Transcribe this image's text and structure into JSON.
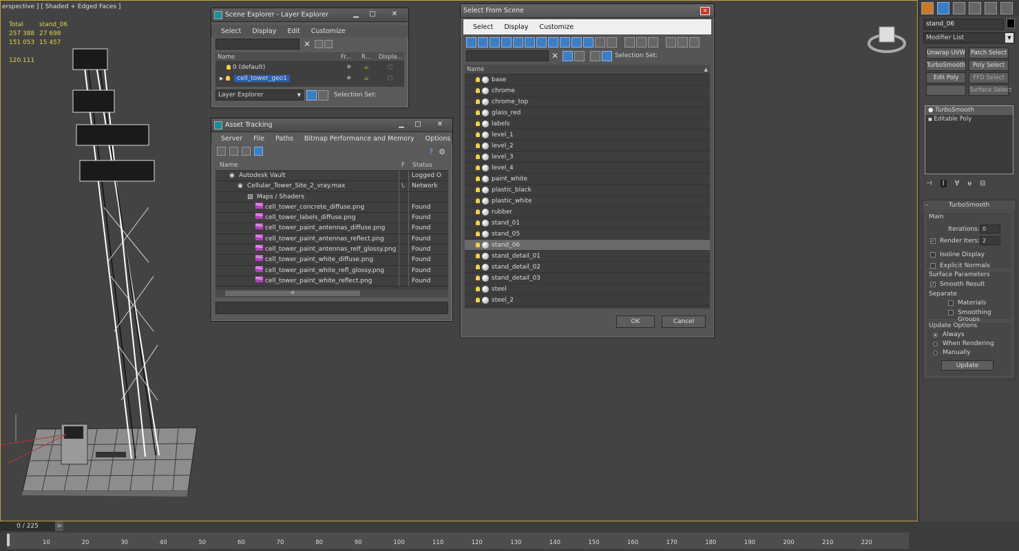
{
  "viewport": {
    "label": "erspective ] [ Shaded + Edged Faces ]",
    "stats": [
      {
        "k": "Total",
        "v": "stand_06"
      },
      {
        "k": "257 388",
        "v": "27 698"
      },
      {
        "k": "151 053",
        "v": "15 457"
      },
      {
        "k": "",
        "v": ""
      },
      {
        "k": "120.111",
        "v": ""
      }
    ]
  },
  "scene_explorer": {
    "title": "Scene Explorer - Layer Explorer",
    "menu": [
      "Select",
      "Display",
      "Edit",
      "Customize"
    ],
    "columns": [
      "Name",
      "Fr...",
      "R...",
      "Displa..."
    ],
    "rows": [
      {
        "name": "0 (default)"
      },
      {
        "name": "cell_tower_geo1"
      }
    ],
    "footer_dropdown": "Layer Explorer",
    "selection_set": "Selection Set:"
  },
  "asset_tracking": {
    "title": "Asset Tracking",
    "menu": [
      "Server",
      "File",
      "Paths",
      "Bitmap Performance and Memory",
      "Options"
    ],
    "columns": [
      "Name",
      "F",
      "Status"
    ],
    "rows": [
      {
        "name": "Autodesk Vault",
        "f": "",
        "status": "Logged O",
        "indent": 1
      },
      {
        "name": "Cellular_Tower_Site_2_vray.max",
        "f": "\\.",
        "status": "Network",
        "indent": 2
      },
      {
        "name": "Maps / Shaders",
        "f": "",
        "status": "",
        "indent": 3
      },
      {
        "name": "cell_tower_concrete_diffuse.png",
        "f": "",
        "status": "Found",
        "indent": 4
      },
      {
        "name": "cell_tower_labels_diffuse.png",
        "f": "",
        "status": "Found",
        "indent": 4
      },
      {
        "name": "cell_tower_paint_antennas_diffuse.png",
        "f": "",
        "status": "Found",
        "indent": 4
      },
      {
        "name": "cell_tower_paint_antennas_reflect.png",
        "f": "",
        "status": "Found",
        "indent": 4
      },
      {
        "name": "cell_tower_paint_antennas_relf_glossy.png",
        "f": "",
        "status": "Found",
        "indent": 4
      },
      {
        "name": "cell_tower_paint_white_diffuse.png",
        "f": "",
        "status": "Found",
        "indent": 4
      },
      {
        "name": "cell_tower_paint_white_refl_glossy.png",
        "f": "",
        "status": "Found",
        "indent": 4
      },
      {
        "name": "cell_tower_paint_white_reflect.png",
        "f": "",
        "status": "Found",
        "indent": 4
      }
    ],
    "scroll_glyph": "III"
  },
  "select_from_scene": {
    "title": "Select From Scene",
    "menu": [
      "Select",
      "Display",
      "Customize"
    ],
    "selection_set": "Selection Set:",
    "name_header": "Name",
    "items": [
      "base",
      "chrome",
      "chrome_top",
      "glass_red",
      "labels",
      "level_1",
      "level_2",
      "level_3",
      "level_4",
      "paint_white",
      "plastic_black",
      "plastic_white",
      "rubber",
      "stand_01",
      "stand_05",
      "stand_06",
      "stand_detail_01",
      "stand_detail_02",
      "stand_detail_03",
      "steel",
      "steel_2"
    ],
    "selected": "stand_06",
    "ok": "OK",
    "cancel": "Cancel"
  },
  "command_panel": {
    "object_name": "stand_06",
    "modifier_list": "Modifier List",
    "buttons": [
      "Unwrap UVW",
      "Patch Select",
      "TurboSmooth",
      "Poly Select",
      "Edit Poly",
      "FFD Select",
      "",
      "Surface Select"
    ],
    "stack": [
      "TurboSmooth",
      "Editable Poly"
    ],
    "rollout": {
      "title": "TurboSmooth",
      "main": "Main",
      "iterations_label": "Iterations:",
      "iterations": "0",
      "render_iters_label": "Render Iters:",
      "render_iters": "2",
      "isoline": "Isoline Display",
      "explicit_normals": "Explicit Normals",
      "surface_params": "Surface Parameters",
      "smooth_result": "Smooth Result",
      "separate": "Separate",
      "materials": "Materials",
      "smoothing_groups": "Smoothing Groups",
      "update_options": "Update Options",
      "always": "Always",
      "when_rendering": "When Rendering",
      "manually": "Manually",
      "update": "Update"
    }
  },
  "timeline": {
    "frame": "0 / 225",
    "arrow": ">",
    "ticks": [
      "10",
      "20",
      "30",
      "40",
      "50",
      "60",
      "70",
      "80",
      "90",
      "100",
      "110",
      "120",
      "130",
      "140",
      "150",
      "160",
      "170",
      "180",
      "190",
      "200",
      "210",
      "220"
    ]
  }
}
